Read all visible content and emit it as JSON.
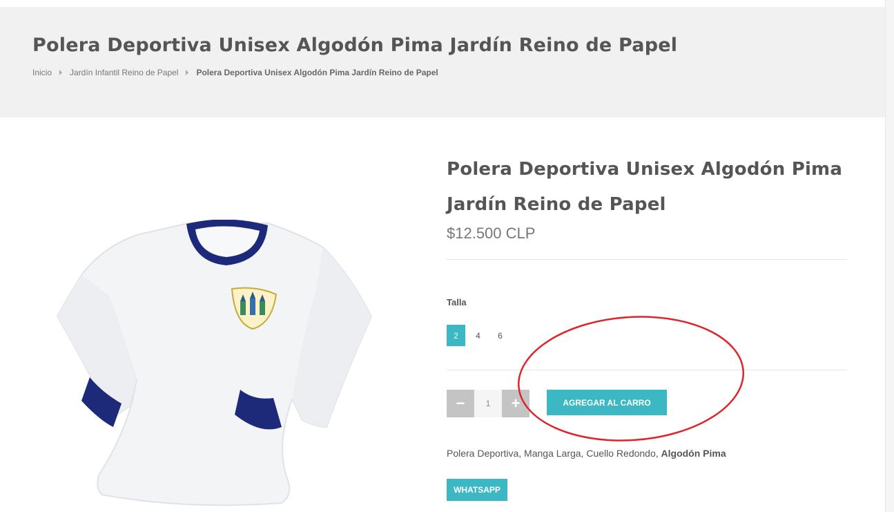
{
  "header": {
    "title": "Polera Deportiva Unisex Algodón Pima Jardín Reino de Papel",
    "breadcrumb": [
      "Inicio",
      "Jardín Infantil Reino de Papel",
      "Polera Deportiva Unisex Algodón Pima Jardín Reino de Papel"
    ]
  },
  "product": {
    "title": "Polera Deportiva Unisex Algodón Pima Jardín Reino de Papel",
    "price": "$12.500 CLP",
    "size_label": "Talla",
    "sizes": [
      "2",
      "4",
      "6"
    ],
    "selected_size": "2",
    "quantity": "1",
    "decrement_label": "−",
    "increment_label": "+",
    "add_to_cart_label": "AGREGAR AL CARRO",
    "description_plain": "Polera Deportiva, Manga Larga, Cuello Redondo, ",
    "description_bold": "Algodón Pima",
    "whatsapp_label": "WHATSAPP",
    "image_icon": "long-sleeve-shirt-image"
  },
  "colors": {
    "accent": "#3bb8c3",
    "header_bg": "#f1f1f1",
    "annotation": "#e0232b",
    "shirt_trim": "#1d2a7a"
  }
}
